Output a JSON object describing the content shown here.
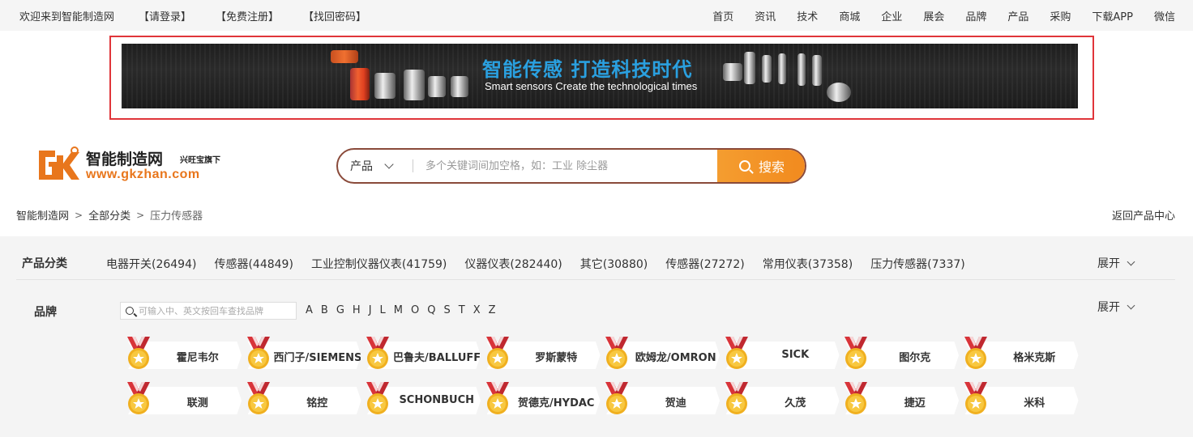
{
  "topbar": {
    "welcome": "欢迎来到智能制造网",
    "login": "【请登录】",
    "register": "【免费注册】",
    "recover": "【找回密码】",
    "nav": [
      "首页",
      "资讯",
      "技术",
      "商城",
      "企业",
      "展会",
      "品牌",
      "产品",
      "采购",
      "下载APP",
      "微信"
    ]
  },
  "banner": {
    "title": "智能传感 打造科技时代",
    "subtitle": "Smart sensors Create the technological times"
  },
  "logo": {
    "name": "智能制造网",
    "tagline": "兴旺宝旗下",
    "url": "www.gkzhan.com"
  },
  "search": {
    "category": "产品",
    "placeholder": "多个关键词间加空格，如：工业 除尘器",
    "button": "搜索"
  },
  "breadcrumb": {
    "items": [
      "智能制造网",
      "全部分类",
      "压力传感器"
    ],
    "separator": ">",
    "back": "返回产品中心"
  },
  "categories": {
    "label": "产品分类",
    "items": [
      "电器开关(26494)",
      "传感器(44849)",
      "工业控制仪器仪表(41759)",
      "仪器仪表(282440)",
      "其它(30880)",
      "传感器(27272)",
      "常用仪表(37358)",
      "压力传感器(7337)"
    ],
    "expand": "展开"
  },
  "brands": {
    "label": "品牌",
    "search_placeholder": "可输入中、英文按回车查找品牌",
    "letters": [
      "A",
      "B",
      "G",
      "H",
      "J",
      "L",
      "M",
      "O",
      "Q",
      "S",
      "T",
      "X",
      "Z"
    ],
    "expand": "展开",
    "rows": [
      [
        "霍尼韦尔",
        "西门子/SIEMENS",
        "巴鲁夫/BALLUFF",
        "罗斯蒙特",
        "欧姆龙/OMRON",
        "SICK",
        "图尔克",
        "格米克斯"
      ],
      [
        "联测",
        "铭控",
        "SCHONBUCH",
        "贺德克/HYDAC",
        "贺迪",
        "久茂",
        "捷迈",
        "米科"
      ]
    ]
  },
  "colors": {
    "accent": "#f28a1e",
    "banner_frame": "#e0353a",
    "banner_title": "#2aa0e0",
    "search_border": "#8a4a3a",
    "medal_ribbon": "#d8343a",
    "medal_gold": "#f0b020"
  }
}
